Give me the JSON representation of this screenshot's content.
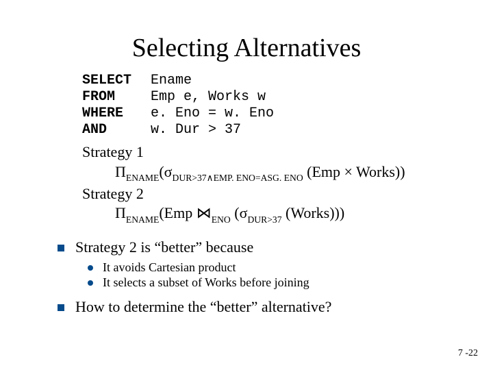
{
  "title": "Selecting Alternatives",
  "sql": {
    "select": {
      "kw": "SELECT",
      "val": "Ename"
    },
    "from": {
      "kw": "FROM",
      "val": "Emp e, Works w"
    },
    "where": {
      "kw": "WHERE",
      "val": "e. Eno = w. Eno"
    },
    "and": {
      "kw": "AND",
      "val": "w. Dur > 37"
    }
  },
  "strat1_label": "Strategy 1",
  "strat1": {
    "proj": "Π",
    "proj_sub": "ENAME",
    "open": "(",
    "sel": "σ",
    "sel_sub": "DUR>37∧EMP. ENO=ASG. ENO",
    "rest": " (Emp × Works))"
  },
  "strat2_label": "Strategy 2",
  "strat2": {
    "proj": "Π",
    "proj_sub": "ENAME",
    "mid1": "(Emp ",
    "join": "⋈",
    "join_sub": "ENO",
    "mid2": " (",
    "sel": "σ",
    "sel_sub": "DUR>37",
    "rest": " (Works)))"
  },
  "bullet1": "Strategy 2 is “better” because",
  "sub1": "It avoids Cartesian product",
  "sub2": "It selects a subset of Works before joining",
  "bullet2": "How to determine the “better” alternative?",
  "pagenum": "7 -22"
}
